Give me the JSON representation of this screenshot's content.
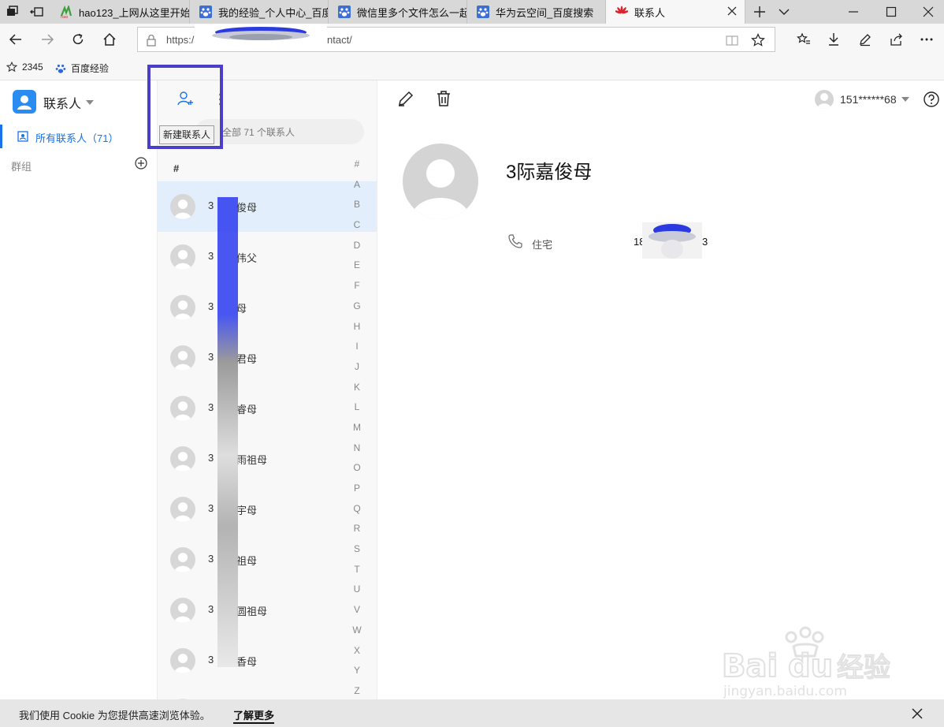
{
  "browser": {
    "tabs": [
      {
        "label": "hao123_上网从这里开始",
        "icon": "hao123-icon"
      },
      {
        "label": "我的经验_个人中心_百度",
        "icon": "baidu-paw-icon"
      },
      {
        "label": "微信里多个文件怎么一起",
        "icon": "baidu-paw-icon"
      },
      {
        "label": "华为云空间_百度搜索",
        "icon": "baidu-paw-icon"
      },
      {
        "label": "联系人",
        "icon": "huawei-icon",
        "active": true
      }
    ],
    "url_start": "https:/",
    "url_end": "ntact/",
    "favorites": [
      {
        "label": "2345"
      },
      {
        "label": "百度经验"
      }
    ]
  },
  "app": {
    "title": "联系人",
    "nav": {
      "all_contacts": "所有联系人（71）",
      "groups": "群组"
    },
    "toolbar": {
      "new_contact_tooltip": "新建联系人",
      "search_placeholder": "全部 71 个联系人"
    },
    "list": {
      "section_header": "#",
      "rows": [
        {
          "prefix": "3",
          "name": "俊母",
          "selected": true
        },
        {
          "prefix": "3",
          "name": "伟父"
        },
        {
          "prefix": "3",
          "name": "母"
        },
        {
          "prefix": "3",
          "name": "君母"
        },
        {
          "prefix": "3",
          "name": "睿母"
        },
        {
          "prefix": "3",
          "name": "雨祖母"
        },
        {
          "prefix": "3",
          "name": "宇母"
        },
        {
          "prefix": "3",
          "name": "祖母"
        },
        {
          "prefix": "3",
          "name": "圆祖母"
        },
        {
          "prefix": "3",
          "name": "香母"
        }
      ],
      "alphabet": [
        "#",
        "A",
        "B",
        "C",
        "D",
        "E",
        "F",
        "G",
        "H",
        "I",
        "J",
        "K",
        "L",
        "M",
        "N",
        "O",
        "P",
        "Q",
        "R",
        "S",
        "T",
        "U",
        "V",
        "W",
        "X",
        "Y",
        "Z"
      ]
    },
    "account": {
      "user": "151******68"
    },
    "detail": {
      "name": "3际嘉俊母",
      "phone_label": "住宅",
      "phone_prefix": "18",
      "phone_suffix": "3"
    },
    "cookie": {
      "message": "我们使用 Cookie 为您提供高速浏览体验。",
      "link": "了解更多"
    },
    "colors": {
      "accent": "#1a73e8",
      "highlight_box": "#4b3fc9",
      "selected_row": "#e2eefb"
    }
  }
}
